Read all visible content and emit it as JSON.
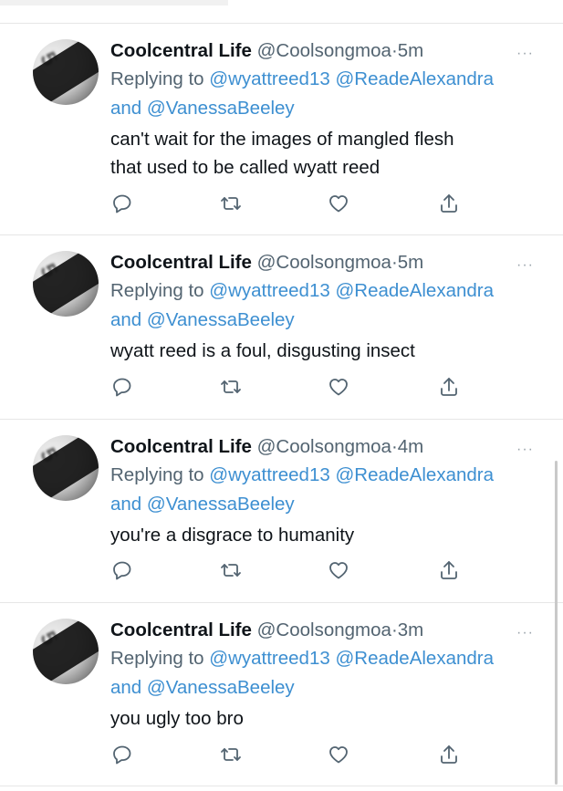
{
  "colors": {
    "accent": "#3d8fd1",
    "secondary_text": "#536471",
    "divider": "#e6e6e6"
  },
  "tweets": [
    {
      "name": "Coolcentral Life",
      "handle": "@Coolsongmoa",
      "time_sep": "·",
      "time": "5m",
      "replying_prefix": "Replying to",
      "mention1": "@wyattreed13",
      "mention2": "@ReadeAlexandra",
      "and": "and",
      "mention3": "@VanessaBeeley",
      "text_line1": "can't wait for the images of mangled flesh",
      "text_line2": "that used to be called wyatt reed"
    },
    {
      "name": "Coolcentral Life",
      "handle": "@Coolsongmoa",
      "time_sep": "·",
      "time": "5m",
      "replying_prefix": "Replying to",
      "mention1": "@wyattreed13",
      "mention2": "@ReadeAlexandra",
      "and": "and",
      "mention3": "@VanessaBeeley",
      "text_line1": "wyatt reed is a foul, disgusting insect",
      "text_line2": ""
    },
    {
      "name": "Coolcentral Life",
      "handle": "@Coolsongmoa",
      "time_sep": "·",
      "time": "4m",
      "replying_prefix": "Replying to",
      "mention1": "@wyattreed13",
      "mention2": "@ReadeAlexandra",
      "and": "and",
      "mention3": "@VanessaBeeley",
      "text_line1": "you're a disgrace to humanity",
      "text_line2": ""
    },
    {
      "name": "Coolcentral Life",
      "handle": "@Coolsongmoa",
      "time_sep": "·",
      "time": "3m",
      "replying_prefix": "Replying to",
      "mention1": "@wyattreed13",
      "mention2": "@ReadeAlexandra",
      "and": "and",
      "mention3": "@VanessaBeeley",
      "text_line1": "you ugly too bro",
      "text_line2": ""
    }
  ],
  "icons": {
    "avatar_digit": "5",
    "more": "···",
    "actions": [
      "reply-icon",
      "retweet-icon",
      "like-icon",
      "share-icon"
    ]
  }
}
